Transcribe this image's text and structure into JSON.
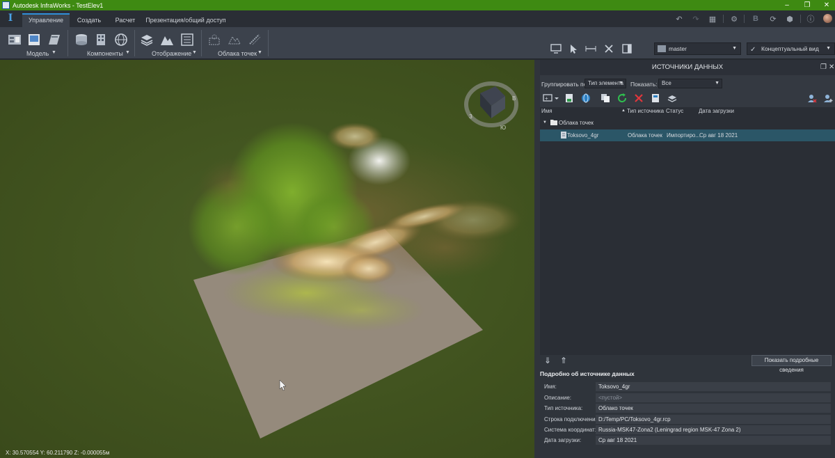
{
  "window": {
    "title": "Autodesk InfraWorks - TestElev1"
  },
  "tabs": [
    {
      "label": "Управление"
    },
    {
      "label": "Создать"
    },
    {
      "label": "Расчет"
    },
    {
      "label": "Презентация/общий доступ"
    }
  ],
  "ribbon": {
    "groups": [
      {
        "label": "Модель"
      },
      {
        "label": "Компоненты"
      },
      {
        "label": "Отображение"
      },
      {
        "label": "Облака точек"
      }
    ],
    "branch_dropdown": "master",
    "style_dropdown": "Концептуальный вид"
  },
  "viewport": {
    "coordinates": "X: 30.570554 Y: 60.211790 Z: -0.000055м",
    "compass": {
      "w": "З",
      "e": "В",
      "s": "Ю"
    }
  },
  "panel": {
    "title": "ИСТОЧНИКИ ДАННЫХ",
    "group_by_label": "Группировать по:",
    "group_by_value": "Тип элемента",
    "show_label": "Показать:",
    "show_value": "Все",
    "columns": {
      "name": "Имя",
      "type": "Тип источника",
      "status": "Статус",
      "date": "Дата загрузки"
    },
    "folder": "Облака точек",
    "rows": [
      {
        "name": "Toksovo_4gr",
        "type": "Облака точек",
        "status": "Импортиро...",
        "date": "Ср авг 18 2021"
      }
    ],
    "details": {
      "button": "Показать подробные сведения",
      "title": "Подробно об источнике данных",
      "fields": [
        {
          "key": "Имя:",
          "value": "Toksovo_4gr"
        },
        {
          "key": "Описание:",
          "value": "<пустой>"
        },
        {
          "key": "Тип источника:",
          "value": "Облако точек"
        },
        {
          "key": "Строка подключения:",
          "value": "D:/Temp/PC/Toksovo_4gr.rcp"
        },
        {
          "key": "Система координат:",
          "value": "Russia-MSK47-Zona2 (Leningrad region MSK-47 Zona 2)"
        },
        {
          "key": "Дата загрузки:",
          "value": "Ср авг 18 2021"
        }
      ]
    }
  }
}
